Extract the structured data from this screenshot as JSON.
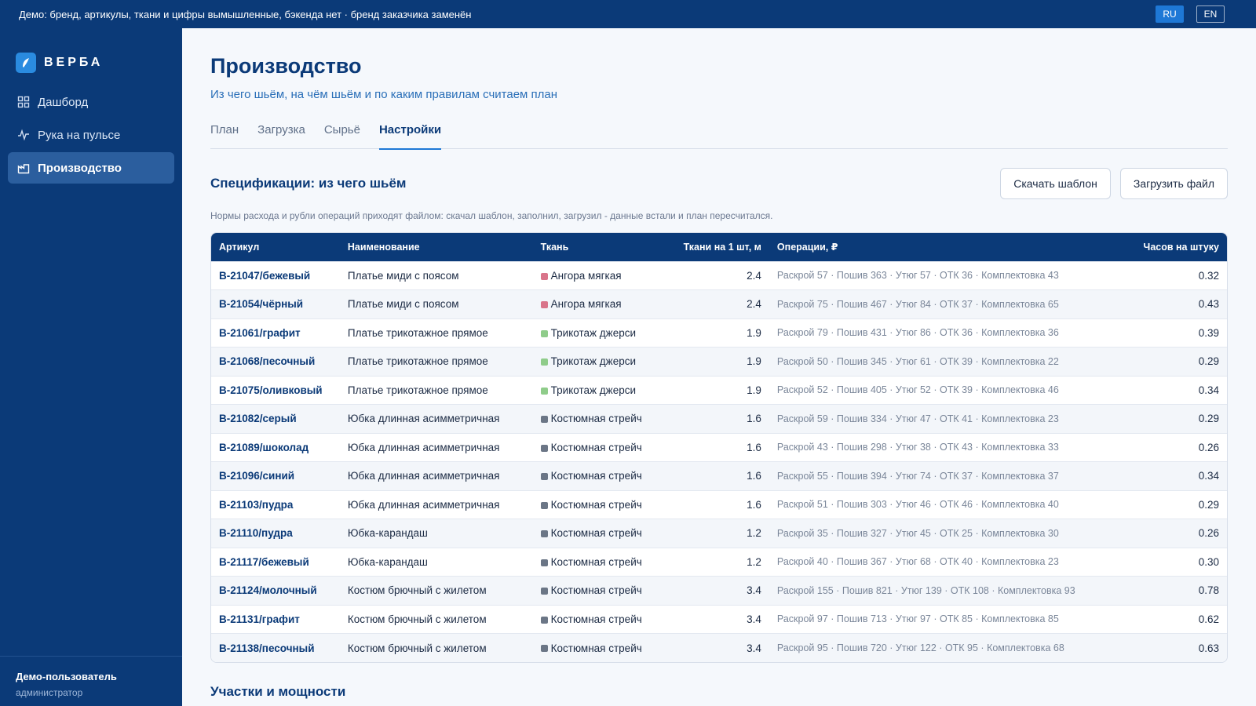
{
  "topbar": {
    "demo_note": "Демо: бренд, артикулы, ткани и цифры вымышленные, бэкенда нет · бренд заказчика заменён",
    "lang": [
      {
        "label": "RU",
        "active": true
      },
      {
        "label": "EN",
        "active": false
      }
    ]
  },
  "sidebar": {
    "logo_text": "ВЕРБА",
    "items": [
      {
        "label": "Дашборд",
        "icon": "dashboard-icon",
        "active": false
      },
      {
        "label": "Рука на пульсе",
        "icon": "pulse-icon",
        "active": false
      },
      {
        "label": "Производство",
        "icon": "production-icon",
        "active": true
      }
    ],
    "user": {
      "name": "Демо-пользователь",
      "role": "администратор"
    }
  },
  "main": {
    "title": "Производство",
    "subtitle": "Из чего шьём, на чём шьём и по каким правилам считаем план",
    "tabs": [
      {
        "label": "План",
        "active": false
      },
      {
        "label": "Загрузка",
        "active": false
      },
      {
        "label": "Сырьё",
        "active": false
      },
      {
        "label": "Настройки",
        "active": true
      }
    ],
    "spec_section": {
      "title": "Спецификации: из чего шьём",
      "download_label": "Скачать шаблон",
      "upload_label": "Загрузить файл",
      "note": "Нормы расхода и рубли операций приходят файлом: скачал шаблон, заполнил, загрузил - данные встали и план пересчитался."
    },
    "table": {
      "headers": [
        "Артикул",
        "Наименование",
        "Ткань",
        "Ткани на 1 шт, м",
        "Операции, ₽",
        "Часов на штуку"
      ],
      "fabric_colors": {
        "Ангора мягкая": "#d9748a",
        "Трикотаж джерси": "#8fcc8a",
        "Костюмная стрейч": "#6b7686"
      },
      "rows": [
        {
          "sku": "В-21047/бежевый",
          "name": "Платье миди с поясом",
          "fabric": "Ангора мягкая",
          "meters": "2.4",
          "ops": "Раскрой 57 · Пошив 363 · Утюг 57 · ОТК 36 · Комплектовка 43",
          "hours": "0.32"
        },
        {
          "sku": "В-21054/чёрный",
          "name": "Платье миди с поясом",
          "fabric": "Ангора мягкая",
          "meters": "2.4",
          "ops": "Раскрой 75 · Пошив 467 · Утюг 84 · ОТК 37 · Комплектовка 65",
          "hours": "0.43"
        },
        {
          "sku": "В-21061/графит",
          "name": "Платье трикотажное прямое",
          "fabric": "Трикотаж джерси",
          "meters": "1.9",
          "ops": "Раскрой 79 · Пошив 431 · Утюг 86 · ОТК 36 · Комплектовка 36",
          "hours": "0.39"
        },
        {
          "sku": "В-21068/песочный",
          "name": "Платье трикотажное прямое",
          "fabric": "Трикотаж джерси",
          "meters": "1.9",
          "ops": "Раскрой 50 · Пошив 345 · Утюг 61 · ОТК 39 · Комплектовка 22",
          "hours": "0.29"
        },
        {
          "sku": "В-21075/оливковый",
          "name": "Платье трикотажное прямое",
          "fabric": "Трикотаж джерси",
          "meters": "1.9",
          "ops": "Раскрой 52 · Пошив 405 · Утюг 52 · ОТК 39 · Комплектовка 46",
          "hours": "0.34"
        },
        {
          "sku": "В-21082/серый",
          "name": "Юбка длинная асимметричная",
          "fabric": "Костюмная стрейч",
          "meters": "1.6",
          "ops": "Раскрой 59 · Пошив 334 · Утюг 47 · ОТК 41 · Комплектовка 23",
          "hours": "0.29"
        },
        {
          "sku": "В-21089/шоколад",
          "name": "Юбка длинная асимметричная",
          "fabric": "Костюмная стрейч",
          "meters": "1.6",
          "ops": "Раскрой 43 · Пошив 298 · Утюг 38 · ОТК 43 · Комплектовка 33",
          "hours": "0.26"
        },
        {
          "sku": "В-21096/синий",
          "name": "Юбка длинная асимметричная",
          "fabric": "Костюмная стрейч",
          "meters": "1.6",
          "ops": "Раскрой 55 · Пошив 394 · Утюг 74 · ОТК 37 · Комплектовка 37",
          "hours": "0.34"
        },
        {
          "sku": "В-21103/пудра",
          "name": "Юбка длинная асимметричная",
          "fabric": "Костюмная стрейч",
          "meters": "1.6",
          "ops": "Раскрой 51 · Пошив 303 · Утюг 46 · ОТК 46 · Комплектовка 40",
          "hours": "0.29"
        },
        {
          "sku": "В-21110/пудра",
          "name": "Юбка-карандаш",
          "fabric": "Костюмная стрейч",
          "meters": "1.2",
          "ops": "Раскрой 35 · Пошив 327 · Утюг 45 · ОТК 25 · Комплектовка 30",
          "hours": "0.26"
        },
        {
          "sku": "В-21117/бежевый",
          "name": "Юбка-карандаш",
          "fabric": "Костюмная стрейч",
          "meters": "1.2",
          "ops": "Раскрой 40 · Пошив 367 · Утюг 68 · ОТК 40 · Комплектовка 23",
          "hours": "0.30"
        },
        {
          "sku": "В-21124/молочный",
          "name": "Костюм брючный с жилетом",
          "fabric": "Костюмная стрейч",
          "meters": "3.4",
          "ops": "Раскрой 155 · Пошив 821 · Утюг 139 · ОТК 108 · Комплектовка 93",
          "hours": "0.78"
        },
        {
          "sku": "В-21131/графит",
          "name": "Костюм брючный с жилетом",
          "fabric": "Костюмная стрейч",
          "meters": "3.4",
          "ops": "Раскрой 97 · Пошив 713 · Утюг 97 · ОТК 85 · Комплектовка 85",
          "hours": "0.62"
        },
        {
          "sku": "В-21138/песочный",
          "name": "Костюм брючный с жилетом",
          "fabric": "Костюмная стрейч",
          "meters": "3.4",
          "ops": "Раскрой 95 · Пошив 720 · Утюг 122 · ОТК 95 · Комплектовка 68",
          "hours": "0.63"
        }
      ]
    },
    "next_section_title": "Участки и мощности"
  }
}
